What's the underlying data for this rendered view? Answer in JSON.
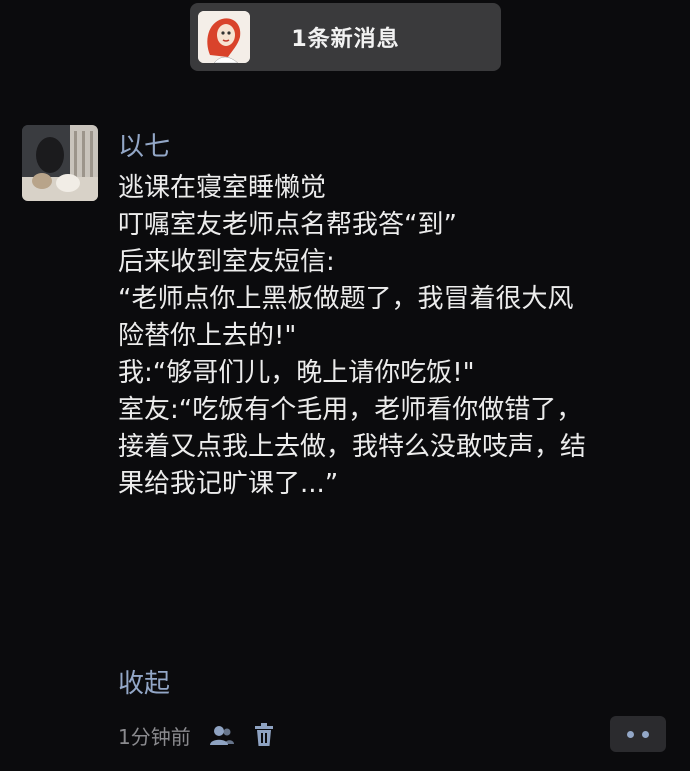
{
  "notification": {
    "text": "1条新消息"
  },
  "post": {
    "username": "以七",
    "lines": [
      "逃课在寝室睡懒觉",
      "叮嘱室友老师点名帮我答“到”",
      "",
      "后来收到室友短信:",
      "“老师点你上黑板做题了，我冒着很大风",
      "险替你上去的!\"",
      "",
      "我:“够哥们儿，晚上请你吃饭!\"",
      "",
      "室友:“吃饭有个毛用，老师看你做错了，",
      "接着又点我上去做，我特么没敢吱声，结",
      "果给我记旷课了...”"
    ],
    "collapse_label": "收起",
    "timestamp": "1分钟前"
  },
  "icons": {
    "notif_avatar": "cartoon-avatar-icon",
    "friends": "friends-icon",
    "delete": "trash-icon",
    "more": "more-dots-icon"
  },
  "colors": {
    "link": "#93a7c7",
    "background": "#0b0b0d",
    "notification_bg": "#3a3a3c"
  }
}
